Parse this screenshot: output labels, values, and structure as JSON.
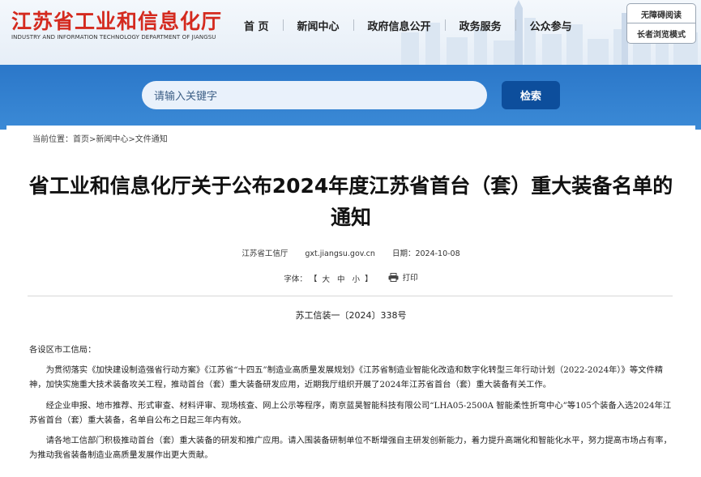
{
  "header": {
    "logo_cn": "江苏省工业和信息化厅",
    "logo_en": "INDUSTRY AND INFORMATION TECHNOLOGY DEPARTMENT OF JIANGSU",
    "nav": [
      "首 页",
      "新闻中心",
      "政府信息公开",
      "政务服务",
      "公众参与"
    ],
    "accessibility_label": "无障碍阅读",
    "elder_mode_label": "长者浏览模式"
  },
  "search": {
    "placeholder": "请输入关键字",
    "button_label": "检索"
  },
  "breadcrumb": {
    "prefix": "当前位置：",
    "home": "首页",
    "sep": ">",
    "news": "新闻中心",
    "current": "文件通知"
  },
  "article": {
    "title": "省工业和信息化厅关于公布2024年度江苏省首台（套）重大装备名单的通知",
    "source": "江苏省工信厅",
    "site": "gxt.jiangsu.gov.cn",
    "date": "日期：2024-10-08",
    "font_size_label": "字体：",
    "bracket_open": "【",
    "font_large": "大",
    "font_medium": "中",
    "font_small": "小",
    "bracket_close": "】",
    "print_label": "打印",
    "doc_number": "苏工信装一〔2024〕338号",
    "paragraphs": [
      "各设区市工信局：",
      "为贯彻落实《加快建设制造强省行动方案》《江苏省“十四五”制造业高质量发展规划》《江苏省制造业智能化改造和数字化转型三年行动计划（2022-2024年）》等文件精神，加快实施重大技术装备攻关工程，推动首台（套）重大装备研发应用，近期我厅组织开展了2024年江苏省首台（套）重大装备有关工作。",
      "经企业申报、地市推荐、形式审查、材料评审、现场核查、网上公示等程序，南京蓝昊智能科技有限公司“LHA05-2500A 智能柔性折弯中心”等105个装备入选2024年江苏省首台（套）重大装备，名单自公布之日起三年内有效。",
      "请各地工信部门积极推动首台（套）重大装备的研发和推广应用。请入围装备研制单位不断增强自主研发创新能力，着力提升高端化和智能化水平，努力提高市场占有率，为推动我省装备制造业高质量发展作出更大贡献。"
    ]
  },
  "colors": {
    "logo_red": "#d42a1f",
    "banner_blue": "#2b77c9",
    "search_button": "#0d4e9c"
  }
}
